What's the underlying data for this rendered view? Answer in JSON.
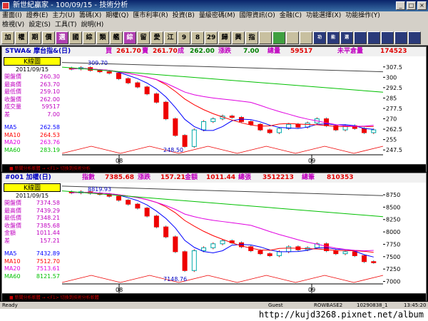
{
  "window": {
    "title": "新世紀贏家 - 100/09/15 - 技術分析",
    "buttons": [
      "_",
      "□",
      "×"
    ]
  },
  "menus": {
    "row1": [
      "畫面(I)",
      "證券(E)",
      "主力(U)",
      "籌碼(X)",
      "期權(Q)",
      "匯市利率(R)",
      "投資(B)",
      "量級密碼(M)",
      "國際資訊(O)",
      "金融(C)",
      "功能選擇(X)",
      "功能操作(Y)"
    ],
    "row2": [
      "檢視(V)",
      "設定(S)",
      "工具(T)",
      "說明(H)"
    ]
  },
  "toolbar": [
    "加",
    "權",
    "期",
    "價",
    "選",
    "國",
    "綜",
    "類",
    "艦",
    "綜",
    "留",
    "愛",
    "江",
    "9",
    "8",
    "29",
    "歸",
    "興",
    "指",
    "",
    "",
    "",
    "",
    "功",
    "能",
    "選",
    "",
    "",
    "",
    "",
    ""
  ],
  "panel1": {
    "header": {
      "symbol": "STWA& 摩台指&(日)",
      "buy_label": "買",
      "buy": "261.70",
      "sell_label": "賣",
      "sell": "261.70",
      "deal_label": "成",
      "deal": "262.00",
      "change_label": "漲跌",
      "change": "7.00",
      "vol_label": "總量",
      "vol": "59517",
      "oi_label": "未平倉量",
      "oi": "174523"
    },
    "kbox": "K線圖",
    "date": "2011/09/15",
    "rows": [
      {
        "label": "開盤價",
        "value": "260.30",
        "color": "#c000c0"
      },
      {
        "label": "最高價",
        "value": "263.70",
        "color": "#c000c0"
      },
      {
        "label": "最低價",
        "value": "259.10",
        "color": "#c000c0"
      },
      {
        "label": "收盤價",
        "value": "262.00",
        "color": "#c000c0"
      },
      {
        "label": "成交量",
        "value": "59517",
        "color": "#c000c0"
      },
      {
        "label": "差",
        "value": "7.00",
        "color": "#c000c0"
      }
    ],
    "ma": [
      {
        "label": "MA5",
        "value": "262.58",
        "color": "#0000ff"
      },
      {
        "label": "MA10",
        "value": "264.53",
        "color": "#ff0000"
      },
      {
        "label": "MA20",
        "value": "263.76",
        "color": "#e000e0"
      },
      {
        "label": "MA60",
        "value": "283.19",
        "color": "#00c000"
      }
    ],
    "yticks": [
      "307.5",
      "300",
      "292.5",
      "285",
      "277.5",
      "270",
      "262.5",
      "255",
      "247.5"
    ],
    "high_label": "309.70",
    "low_label": "248.50",
    "xlabels": [
      "08",
      "09"
    ],
    "footer": "■ 新聞分析軟體 → <F1> 切換到技術分析"
  },
  "panel2": {
    "header": {
      "symbol": "#001 加權(日)",
      "idx_label": "指數",
      "idx": "7385.68",
      "change_label": "漲跌",
      "change": "157.21",
      "amt_label": "金額",
      "amt": "1011.44",
      "vol_label": "總張",
      "vol": "3512213",
      "cnt_label": "總筆",
      "cnt": "810353"
    },
    "kbox": "K線圖",
    "date": "2011/09/15",
    "rows": [
      {
        "label": "開盤價",
        "value": "7374.58",
        "color": "#c000c0"
      },
      {
        "label": "最高價",
        "value": "7439.29",
        "color": "#c000c0"
      },
      {
        "label": "最低價",
        "value": "7348.21",
        "color": "#c000c0"
      },
      {
        "label": "收盤價",
        "value": "7385.68",
        "color": "#c000c0"
      },
      {
        "label": "金額",
        "value": "1011.44",
        "color": "#c000c0"
      },
      {
        "label": "差",
        "value": "157.21",
        "color": "#c000c0"
      }
    ],
    "ma": [
      {
        "label": "MA5",
        "value": "7432.89",
        "color": "#0000ff"
      },
      {
        "label": "MA10",
        "value": "7512.70",
        "color": "#ff0000"
      },
      {
        "label": "MA20",
        "value": "7513.61",
        "color": "#e000e0"
      },
      {
        "label": "MA60",
        "value": "8121.57",
        "color": "#00c000"
      }
    ],
    "yticks": [
      "8750",
      "8500",
      "8250",
      "8000",
      "7750",
      "7500",
      "7250",
      "7000"
    ],
    "high_label": "8819.93",
    "low_label": "7148.76",
    "xlabels": [
      "08",
      "09"
    ],
    "footer": "■ 新聞分析軟體 → <F1> 切換到技術分析軟體"
  },
  "status": {
    "left": "Ready",
    "mid1": "Guest",
    "mid2": "ROWBASE2",
    "mid3": "10290838_1",
    "time": "13:45:20"
  },
  "watermark": "http://kujd3268.pixnet.net/album",
  "colors": {
    "up": "#ff3030",
    "down": "#00ffff",
    "ma5": "#0000ff",
    "ma10": "#ff0000",
    "ma20": "#e000e0",
    "ma60": "#00c000"
  }
}
